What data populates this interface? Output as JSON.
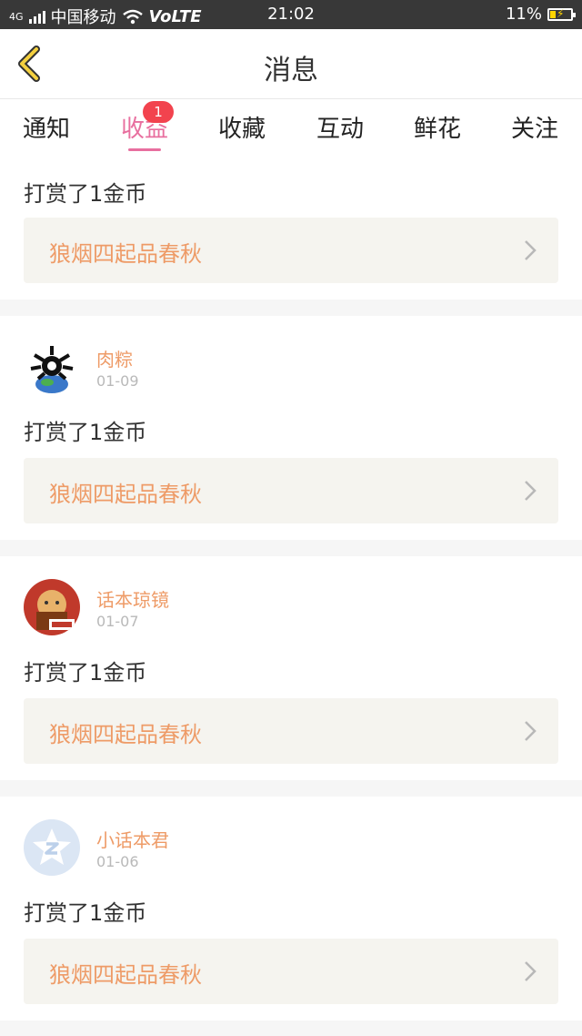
{
  "status_bar": {
    "net": "4G",
    "carrier": "中国移动",
    "volte": "VoLTE",
    "time": "21:02",
    "battery": "11%"
  },
  "header": {
    "title": "消息"
  },
  "tabs": [
    {
      "label": "通知"
    },
    {
      "label": "收益",
      "badge": "1"
    },
    {
      "label": "收藏"
    },
    {
      "label": "互动"
    },
    {
      "label": "鲜花"
    },
    {
      "label": "关注"
    }
  ],
  "first_card": {
    "action": "打赏了1金币",
    "book": "狼烟四起品春秋"
  },
  "messages": [
    {
      "user": "肉粽",
      "date": "01-09",
      "action": "打赏了1金币",
      "book": "狼烟四起品春秋"
    },
    {
      "user": "话本琼镜",
      "date": "01-07",
      "action": "打赏了1金币",
      "book": "狼烟四起品春秋"
    },
    {
      "user": "小话本君",
      "date": "01-06",
      "action": "打赏了1金币",
      "book": "狼烟四起品春秋"
    }
  ],
  "colors": {
    "accent": "#e86f9f",
    "username": "#ee9b67",
    "badge": "#f2434e",
    "back_arrow": "#f4d03f"
  }
}
